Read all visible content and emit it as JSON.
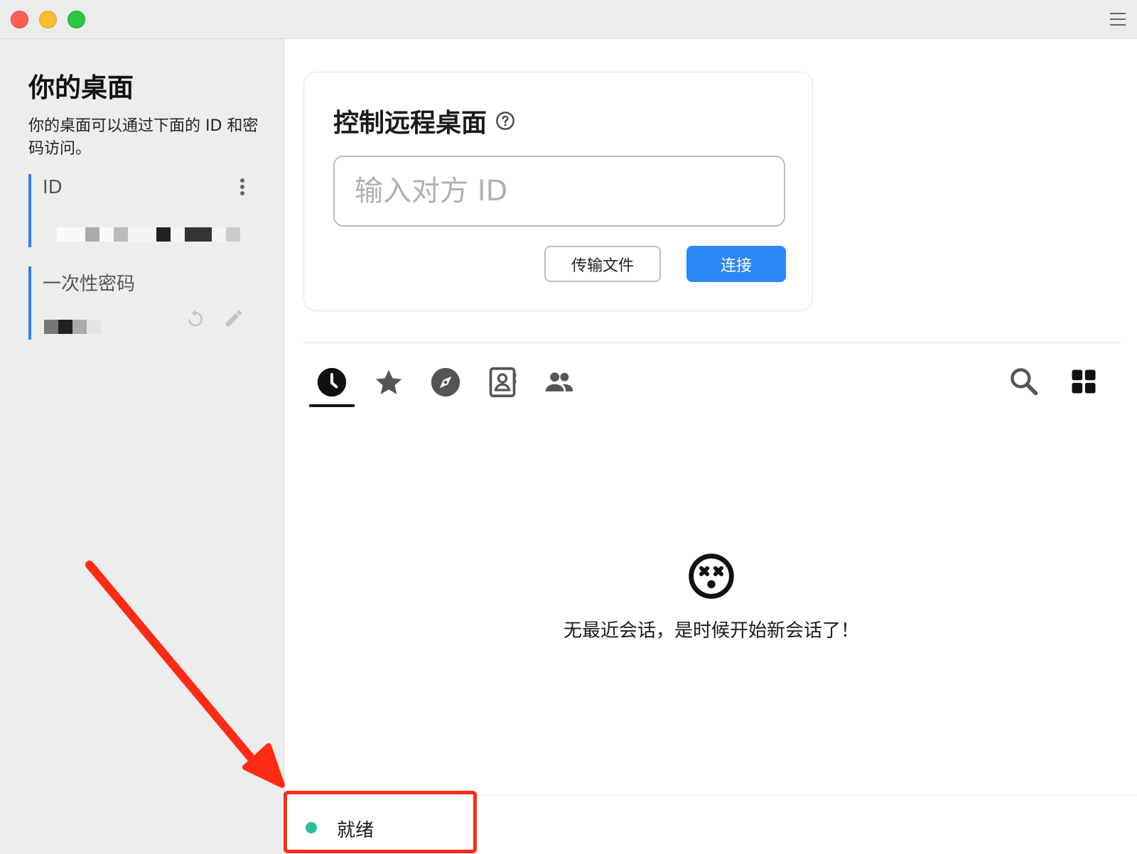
{
  "window": {
    "menu_icon": "hamburger-icon"
  },
  "sidebar": {
    "title": "你的桌面",
    "description": "你的桌面可以通过下面的 ID 和密码访问。",
    "id_label": "ID",
    "password_label": "一次性密码"
  },
  "remote": {
    "title": "控制远程桌面",
    "input_placeholder": "输入对方 ID",
    "transfer_label": "传输文件",
    "connect_label": "连接"
  },
  "tabs": [
    {
      "icon": "clock-icon",
      "active": true
    },
    {
      "icon": "star-icon",
      "active": false
    },
    {
      "icon": "compass-icon",
      "active": false
    },
    {
      "icon": "address-book-icon",
      "active": false
    },
    {
      "icon": "group-icon",
      "active": false
    }
  ],
  "empty_state": {
    "icon": "dizzy-face-icon",
    "message": "无最近会话，是时候开始新会话了！"
  },
  "status": {
    "text": "就绪",
    "dot_color": "#2fbd9b"
  },
  "colors": {
    "accent": "#2c87f7",
    "annotation": "#ff2b15"
  }
}
